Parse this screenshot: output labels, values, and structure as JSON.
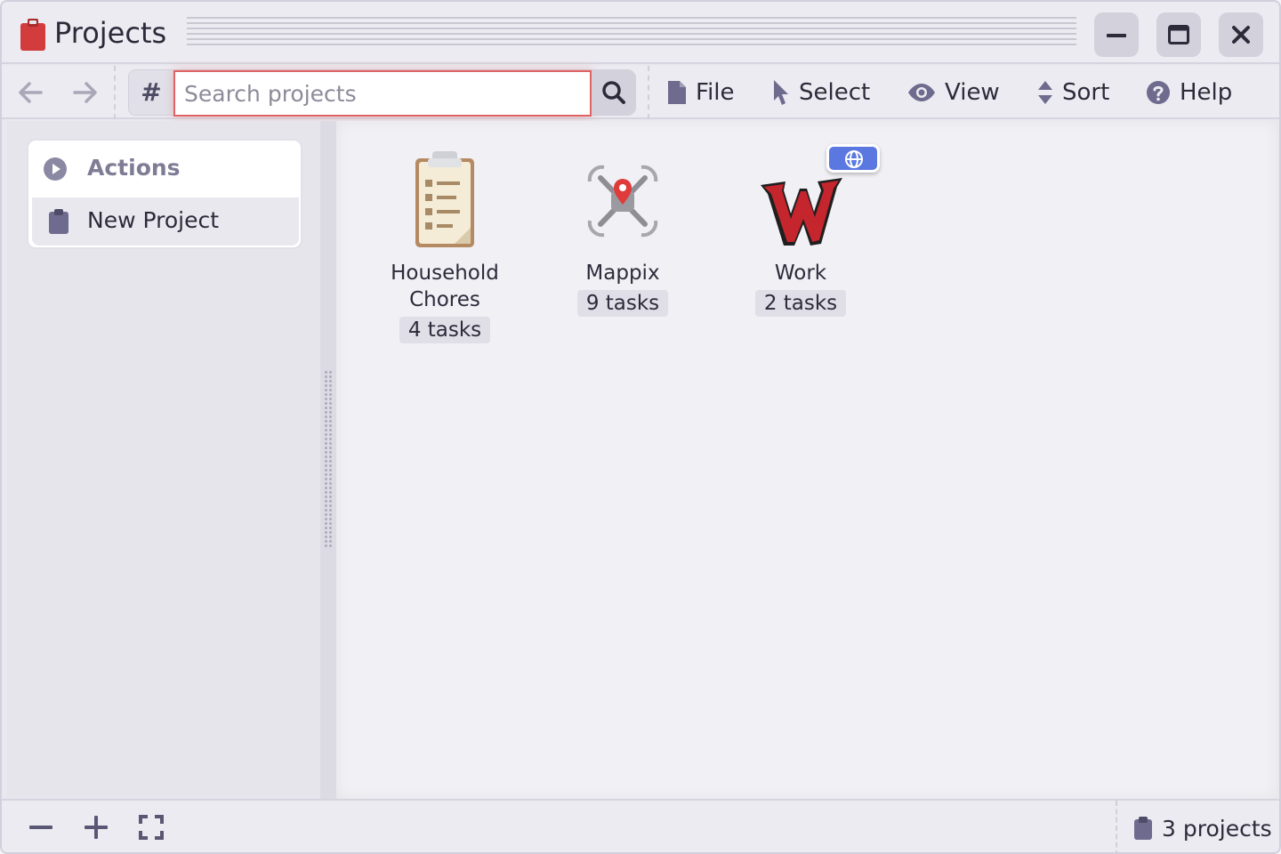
{
  "window": {
    "title": "Projects",
    "app_icon": "clipboard-icon",
    "controls": [
      "minimize-icon",
      "maximize-icon",
      "close-icon"
    ]
  },
  "toolbar": {
    "back_icon": "arrow-left-icon",
    "forward_icon": "arrow-right-icon",
    "hash_symbol": "#",
    "search": {
      "placeholder": "Search projects",
      "value": ""
    },
    "search_icon": "magnifier-icon",
    "menu": {
      "file": "File",
      "select": "Select",
      "view": "View",
      "sort": "Sort",
      "help": "Help"
    }
  },
  "sidebar": {
    "actions_label": "Actions",
    "items": [
      {
        "label": "New Project",
        "icon": "clipboard-icon"
      }
    ]
  },
  "projects": [
    {
      "name_line1": "Household",
      "name_line2": "Chores",
      "tasks": "4 tasks",
      "icon": "clipboard-document-icon"
    },
    {
      "name_line1": "Mappix",
      "tasks": "9 tasks",
      "icon": "drone-map-pin-icon"
    },
    {
      "name_line1": "Work",
      "tasks": "2 tasks",
      "icon": "letter-w-logo-icon",
      "badge": "globe-icon"
    }
  ],
  "statusbar": {
    "count": "3 projects",
    "buttons": [
      "minus-icon",
      "plus-icon",
      "fullscreen-icon"
    ]
  },
  "colors": {
    "accent_red": "#d23c3c",
    "search_border": "#e06363",
    "badge_blue": "#5a78e0",
    "icon_purple": "#6e6b8e"
  }
}
